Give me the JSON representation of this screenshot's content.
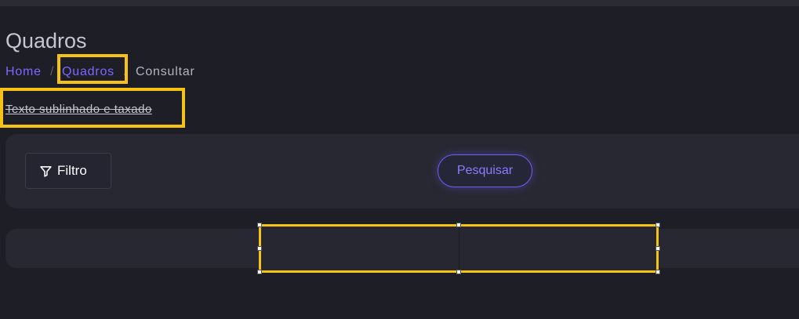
{
  "page": {
    "title": "Quadros"
  },
  "breadcrumb": {
    "home": "Home",
    "separator": "/",
    "section": "Quadros",
    "current": "Consultar"
  },
  "content": {
    "styled_text": "Texto sublinhado e taxado"
  },
  "filter_panel": {
    "filter_label": "Filtro",
    "filter_icon": "filter-icon",
    "search_label": "Pesquisar"
  },
  "colors": {
    "background": "#1d1e26",
    "panel": "#272832",
    "accent": "#7f67ff",
    "highlight": "#f5c215"
  }
}
